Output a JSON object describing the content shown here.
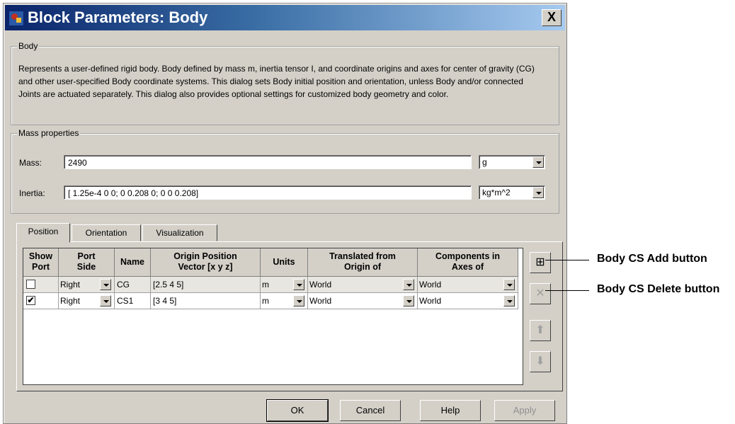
{
  "window": {
    "title": "Block Parameters: Body",
    "close_label": "X"
  },
  "body_group": {
    "legend": "Body",
    "description": "Represents a user-defined rigid body. Body defined by mass m, inertia tensor I, and coordinate origins and axes for center of gravity (CG) and other user-specified Body coordinate systems. This dialog sets Body initial position and orientation, unless Body and/or connected Joints are actuated separately. This dialog also provides optional settings for customized body geometry and color."
  },
  "mass_props": {
    "legend": "Mass properties",
    "mass_label": "Mass:",
    "mass_value": "2490",
    "mass_unit": "g",
    "inertia_label": "Inertia:",
    "inertia_value": "[ 1.25e-4 0 0; 0 0.208 0; 0 0 0.208]",
    "inertia_unit": "kg*m^2"
  },
  "tabs": [
    "Position",
    "Orientation",
    "Visualization"
  ],
  "table": {
    "headers": [
      "Show\nPort",
      "Port\nSide",
      "Name",
      "Origin Position\nVector [x y z]",
      "Units",
      "Translated from\nOrigin of",
      "Components in\nAxes of"
    ],
    "rows": [
      {
        "show": "",
        "side": "Right",
        "name": "CG",
        "vector": "[2.5 4 5]",
        "units": "m",
        "from": "World",
        "axes": "World"
      },
      {
        "show": "✔",
        "side": "Right",
        "name": "CS1",
        "vector": "[3 4 5]",
        "units": "m",
        "from": "World",
        "axes": "World"
      }
    ]
  },
  "side_buttons": {
    "add": "⊞",
    "delete": "✕",
    "up": "⬆",
    "down": "⬇"
  },
  "buttons": {
    "ok": "OK",
    "cancel": "Cancel",
    "help": "Help",
    "apply": "Apply"
  },
  "callouts": {
    "add": "Body CS Add button",
    "delete": "Body CS Delete button"
  }
}
